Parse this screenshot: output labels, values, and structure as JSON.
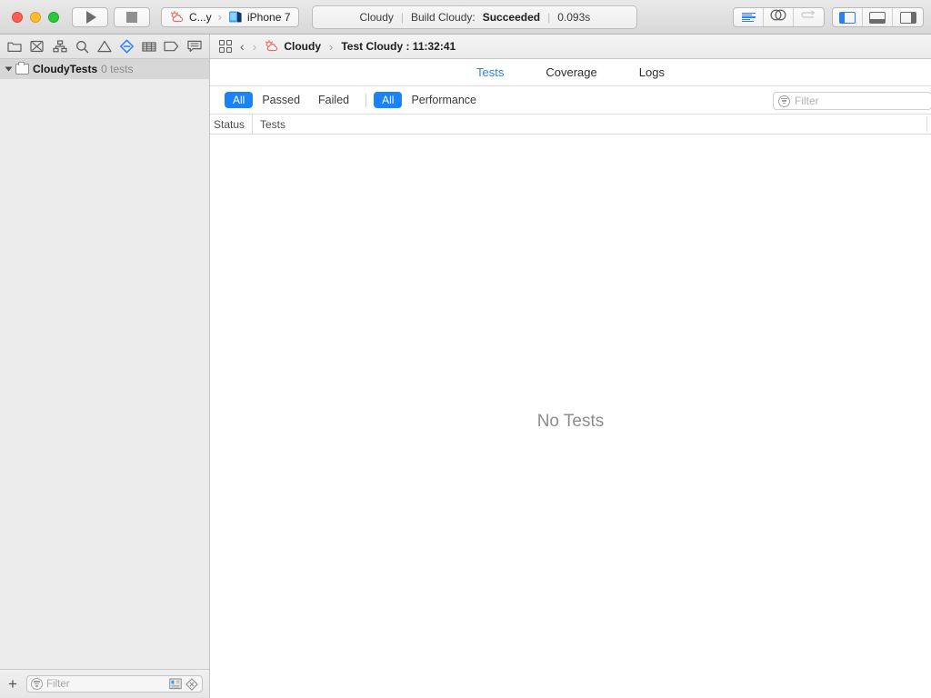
{
  "window": {
    "traffic_lights": [
      "close",
      "minimize",
      "zoom"
    ],
    "colors": {
      "close": "#ff5f57",
      "minimize": "#febc2e",
      "zoom": "#28c840",
      "accent": "#2d7ff9",
      "pill": "#1a82fb"
    }
  },
  "toolbar": {
    "run_label": "Run",
    "stop_label": "Stop",
    "scheme": {
      "name": "C...y",
      "separator": "›",
      "destination": "iPhone 7"
    },
    "status": {
      "project": "Cloudy",
      "separator": "|",
      "action": "Build Cloudy:",
      "result": "Succeeded",
      "duration": "0.093s"
    },
    "editor_modes": [
      {
        "name": "standard-editor",
        "active": true
      },
      {
        "name": "assistant-editor",
        "active": false
      },
      {
        "name": "version-editor",
        "active": false,
        "disabled": true
      }
    ],
    "view_toggles": [
      {
        "name": "navigator",
        "active": true
      },
      {
        "name": "debug-area",
        "active": false
      },
      {
        "name": "utilities",
        "active": false
      }
    ]
  },
  "navigator": {
    "tabs": [
      {
        "name": "project-navigator",
        "icon": "folder-icon",
        "active": false
      },
      {
        "name": "source-control-navigator",
        "icon": "source-control-icon",
        "active": false
      },
      {
        "name": "symbol-navigator",
        "icon": "hierarchy-icon",
        "active": false
      },
      {
        "name": "find-navigator",
        "icon": "search-icon",
        "active": false
      },
      {
        "name": "issue-navigator",
        "icon": "warning-icon",
        "active": false
      },
      {
        "name": "test-navigator",
        "icon": "diamond-icon",
        "active": true
      },
      {
        "name": "debug-navigator",
        "icon": "grid-icon",
        "active": false
      },
      {
        "name": "breakpoint-navigator",
        "icon": "tag-icon",
        "active": false
      },
      {
        "name": "report-navigator",
        "icon": "speech-bubble-icon",
        "active": false
      }
    ],
    "rows": [
      {
        "name": "CloudyTests",
        "count": "0 tests",
        "expanded": true,
        "selected": true
      }
    ],
    "bottom": {
      "add_label": "+",
      "filter_placeholder": "Filter",
      "filter_value": "",
      "right_icons": [
        "panel-list-icon",
        "failed-tests-icon"
      ]
    }
  },
  "jumpbar": {
    "related_items_icon": "grid-icon",
    "back_label": "‹",
    "forward_label": "›",
    "path": [
      {
        "label": "Cloudy",
        "icon": "app-icon"
      },
      {
        "label": "Test Cloudy : 11:32:41",
        "icon": ""
      }
    ],
    "separator": "›"
  },
  "report": {
    "tabs": [
      {
        "label": "Tests",
        "active": true
      },
      {
        "label": "Coverage",
        "active": false
      },
      {
        "label": "Logs",
        "active": false
      }
    ],
    "filters": {
      "status": [
        {
          "label": "All",
          "selected": true
        },
        {
          "label": "Passed",
          "selected": false
        },
        {
          "label": "Failed",
          "selected": false
        }
      ],
      "kind": [
        {
          "label": "All",
          "selected": true
        },
        {
          "label": "Performance",
          "selected": false
        }
      ],
      "search_placeholder": "Filter",
      "search_value": ""
    },
    "columns": [
      "Status",
      "Tests"
    ],
    "rows": [],
    "empty_message": "No Tests"
  }
}
